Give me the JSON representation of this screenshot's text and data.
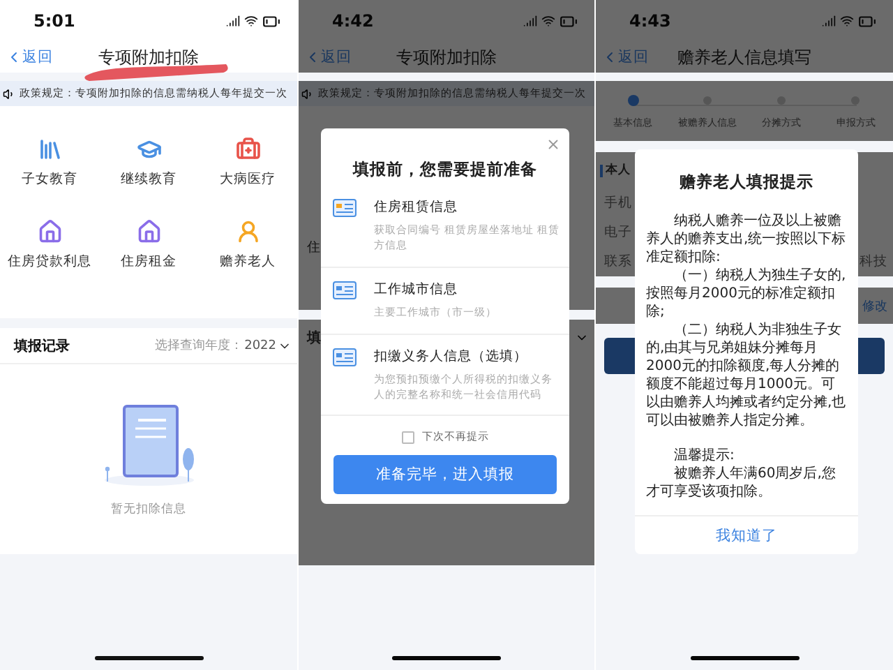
{
  "phones": [
    {
      "kind": "deductions",
      "time": "5:01",
      "back": "返回",
      "title": "专项附加扣除",
      "notice": "政策规定：专项附加扣除的信息需纳税人每年提交一次",
      "categories": [
        {
          "label": "子女教育"
        },
        {
          "label": "继续教育"
        },
        {
          "label": "大病医疗"
        },
        {
          "label": "住房贷款利息"
        },
        {
          "label": "住房租金"
        },
        {
          "label": "赡养老人"
        }
      ],
      "records_title": "填报记录",
      "year_label": "选择查询年度：",
      "year": "2022",
      "empty_text": "暂无扣除信息"
    },
    {
      "kind": "deductions_dialog",
      "time": "4:42",
      "back": "返回",
      "title": "专项附加扣除",
      "notice": "政策规定：专项附加扣除的信息需纳税人每年提交一次",
      "behind": {
        "grid_label": "住",
        "records_title": "填"
      },
      "dialog": {
        "title": "填报前，您需要提前准备",
        "items": [
          {
            "title": "住房租赁信息",
            "desc": "获取合同编号 租赁房屋坐落地址 租赁方信息"
          },
          {
            "title": "工作城市信息",
            "desc": "主要工作城市（市一级）"
          },
          {
            "title": "扣缴义务人信息（选填）",
            "desc": "为您预扣预缴个人所得税的扣缴义务人的完整名称和统一社会信用代码"
          }
        ],
        "checkbox": {
          "label": "下次不再提示",
          "checked": false
        },
        "button": "准备完毕，进入填报"
      }
    },
    {
      "kind": "elderly",
      "time": "4:43",
      "back": "返回",
      "title": "赡养老人信息填写",
      "steps": [
        {
          "label": "基本信息",
          "selected": true
        },
        {
          "label": "被赡养人信息",
          "selected": false
        },
        {
          "label": "分摊方式",
          "selected": false
        },
        {
          "label": "申报方式",
          "selected": false
        }
      ],
      "behind": {
        "section_title": "本人",
        "fields": [
          {
            "label": "手机"
          },
          {
            "label": "电子"
          },
          {
            "label": "联系",
            "value": "科技"
          }
        ],
        "edit_link": "修改"
      },
      "dialog": {
        "title": "赡养老人填报提示",
        "paragraphs": [
          "纳税人赡养一位及以上被赡养人的赡养支出,统一按照以下标准定额扣除:",
          "（一）纳税人为独生子女的,按照每月2000元的标准定额扣除;",
          "（二）纳税人为非独生子女的,由其与兄弟姐妹分摊每月2000元的扣除额度,每人分摊的额度不能超过每月1000元。可以由赡养人均摊或者约定分摊,也可以由被赡养人指定分摊。",
          "温馨提示:",
          "被赡养人年满60周岁后,您才可享受该项扣除。"
        ],
        "button": "我知道了"
      }
    }
  ]
}
